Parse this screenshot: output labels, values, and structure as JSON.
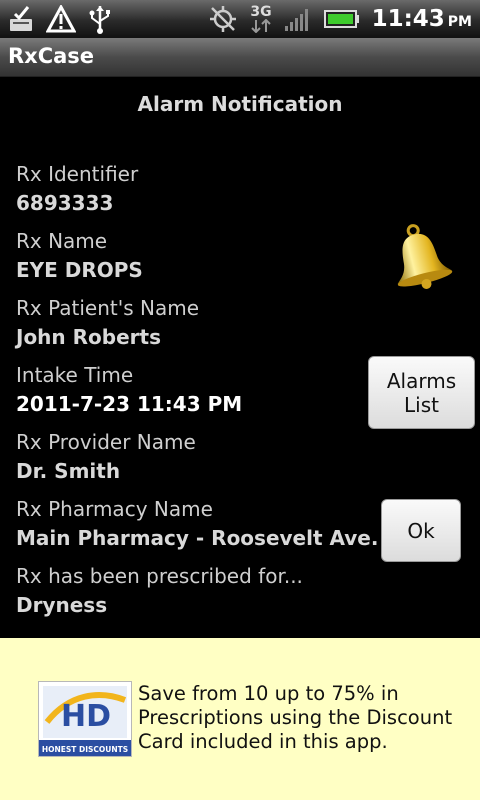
{
  "status_bar": {
    "time": "11:43",
    "ampm": "PM",
    "network": "3G",
    "icons": [
      "task-check-icon",
      "warning-icon",
      "usb-icon",
      "gps-off-icon",
      "signal-icon",
      "battery-icon"
    ]
  },
  "app": {
    "title": "RxCase"
  },
  "screen": {
    "heading": "Alarm Notification"
  },
  "fields": [
    {
      "label": "Rx Identifier",
      "value": "6893333"
    },
    {
      "label": "Rx Name",
      "value": "EYE DROPS"
    },
    {
      "label": "Rx Patient's Name",
      "value": "John Roberts"
    },
    {
      "label": "Intake Time",
      "value": "2011-7-23 11:43 PM"
    },
    {
      "label": "Rx Provider Name",
      "value": "Dr. Smith"
    },
    {
      "label": "Rx Pharmacy Name",
      "value": "Main Pharmacy - Roosevelt Ave."
    },
    {
      "label": "Rx has been prescribed for...",
      "value": "Dryness"
    }
  ],
  "buttons": {
    "alarms_list_line1": "Alarms",
    "alarms_list_line2": "List",
    "ok": "Ok"
  },
  "icons": {
    "alert": "bell-icon"
  },
  "ad": {
    "logo_letters": "HD",
    "logo_caption": "HONEST DISCOUNTS",
    "line1": "Save from 10 up to 75% in",
    "line2": "Prescriptions using the Discount",
    "line3": "Card included in this app."
  },
  "colors": {
    "background": "#000000",
    "ad_background": "#ffffc4",
    "battery": "#3ecb2c",
    "logo_blue": "#2b4ea2",
    "logo_gold": "#f2b51c"
  }
}
